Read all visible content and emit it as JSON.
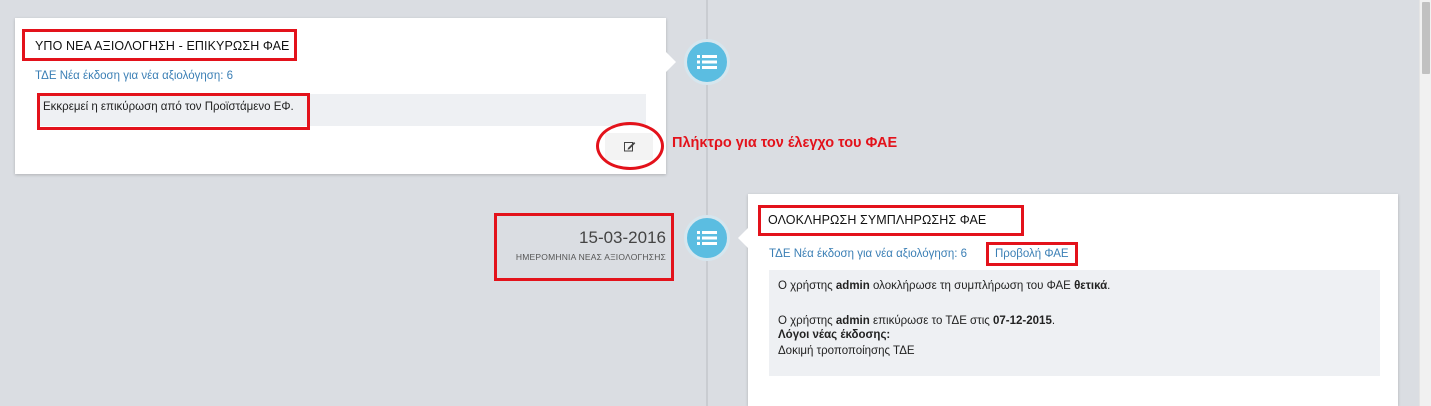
{
  "timeline": {
    "entry_1": {
      "title": "ΥΠΟ ΝΕΑ ΑΞΙΟΛΟΓΗΣΗ - ΕΠΙΚΥΡΩΣΗ ΦΑΕ",
      "tde_link": "ΤΔΕ Νέα έκδοση για νέα αξιολόγηση: 6",
      "message": "Εκκρεμεί η επικύρωση από τον Προϊστάμενο ΕΦ.",
      "edit_button_icon": "edit-icon"
    },
    "annotation": "Πλήκτρο για τον έλεγχο του ΦΑΕ",
    "entry_2": {
      "date": "15-03-2016",
      "date_caption": "ΗΜΕΡΟΜΗΝΙΑ ΝΕΑΣ ΑΞΙΟΛΟΓΗΣΗΣ",
      "title": "ΟΛΟΚΛΗΡΩΣΗ ΣΥΜΠΛΗΡΩΣΗΣ ΦΑΕ",
      "tde_link": "ΤΔΕ Νέα έκδοση για νέα αξιολόγηση: 6",
      "view_link": "Προβολή ΦΑΕ",
      "line1_prefix": "Ο χρήστης",
      "line1_user": "admin",
      "line1_middle": "ολοκλήρωσε τη συμπλήρωση του ΦΑΕ",
      "line1_result": "θετικά",
      "line1_end": ".",
      "line2_prefix": "Ο χρήστης",
      "line2_user": "admin",
      "line2_middle": "επικύρωσε το ΤΔΕ στις",
      "line2_date": "07-12-2015",
      "line2_end": ".",
      "reasons_label": "Λόγοι νέας έκδοσης:",
      "reasons_text": "Δοκιμή τροποποίησης ΤΔΕ"
    }
  },
  "colors": {
    "background": "#dadde2",
    "accent_blue": "#5bbde1",
    "link_blue": "#3b7fb5",
    "highlight_red": "#e3121b"
  },
  "icons": {
    "timeline_marker": "list-icon"
  }
}
